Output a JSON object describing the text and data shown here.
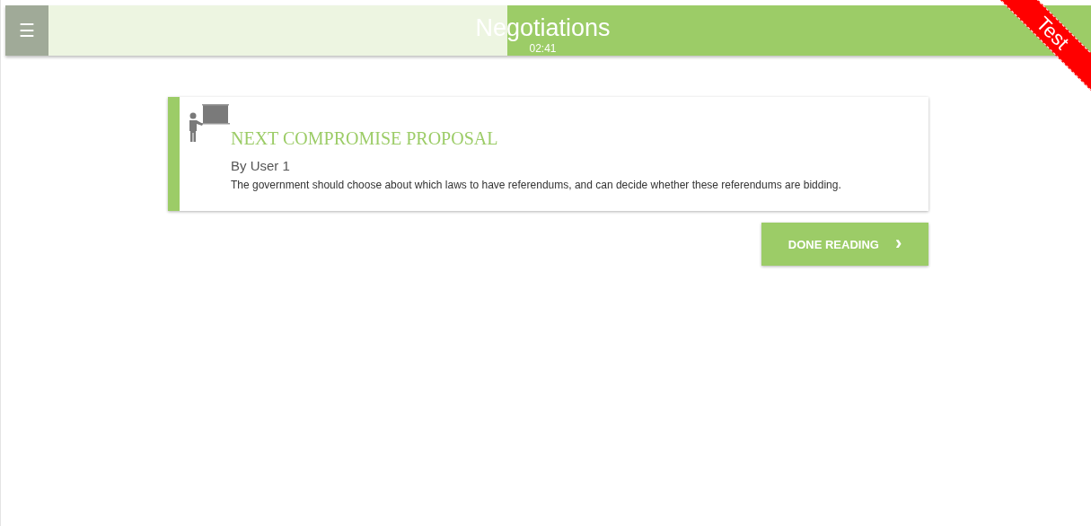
{
  "header": {
    "menu_icon": "☰",
    "title": "Negotiations",
    "timer": "02:41",
    "time_progress": {
      "level": 0.44
    }
  },
  "ribbon": {
    "label": "Test"
  },
  "proposal": {
    "heading": "NEXT COMPROMISE PROPOSAL",
    "author": "By User 1",
    "text": "The government should choose about which laws to have referendums, and can decide whether these referendums are bidding."
  },
  "button": {
    "label": "DONE READING",
    "icon": "›"
  }
}
